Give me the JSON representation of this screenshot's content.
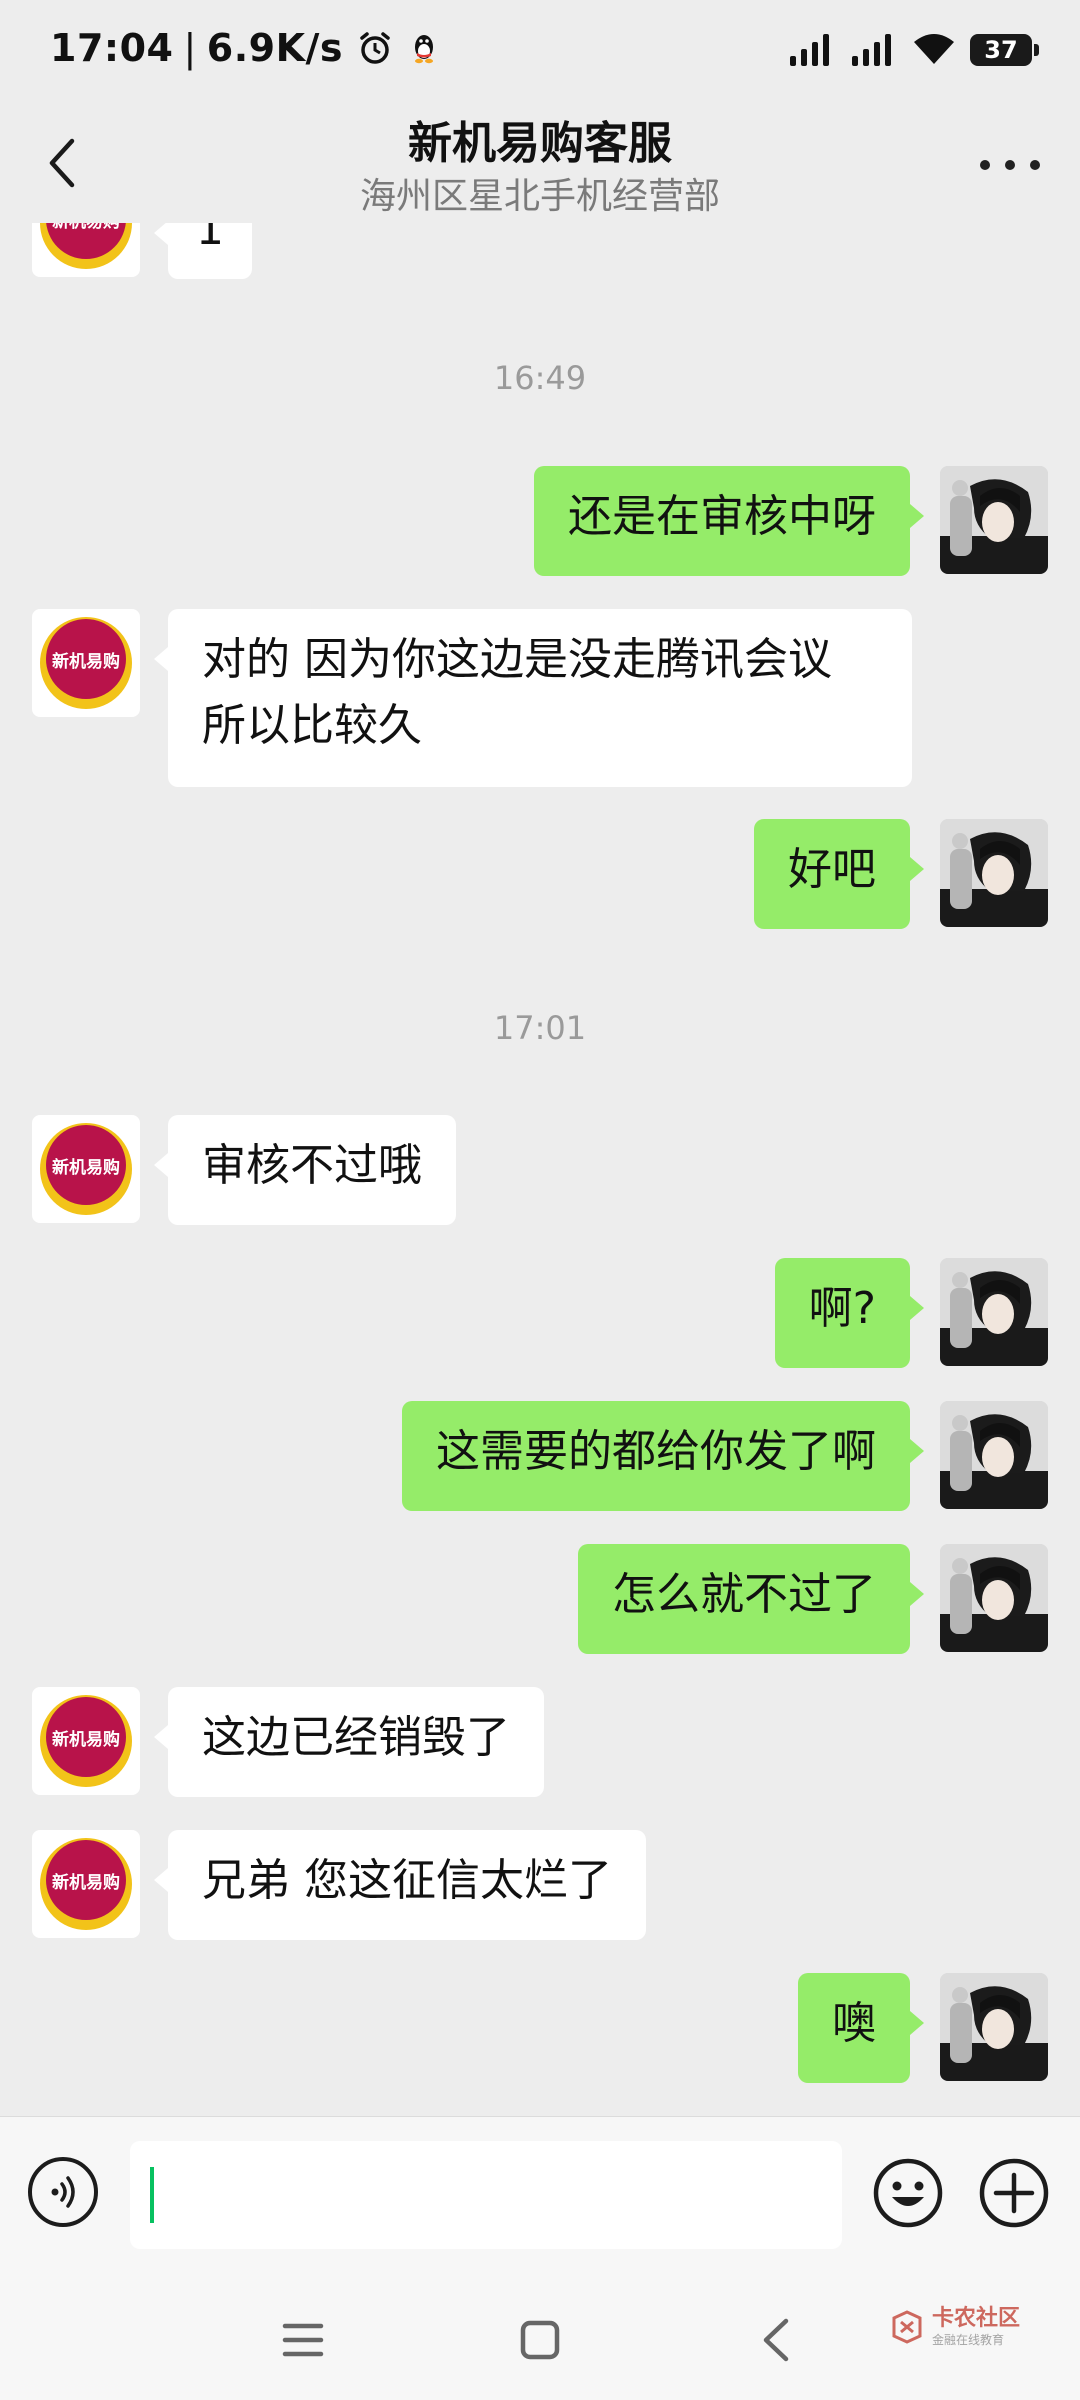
{
  "status_bar": {
    "time": "17:04",
    "speed": "6.9K/s",
    "battery": "37"
  },
  "header": {
    "title": "新机易购客服",
    "subtitle": "海州区星北手机经营部"
  },
  "contact_avatar": {
    "logo_text": "新机易购"
  },
  "messages": {
    "partial": "1",
    "time1": "16:49",
    "m1": "还是在审核中呀",
    "m2_line1": "对的 因为你这边是没走腾讯会议",
    "m2_line2": "所以比较久",
    "m3": "好吧",
    "time2": "17:01",
    "m4": "审核不过哦",
    "m5": "啊?",
    "m6": "这需要的都给你发了啊",
    "m7": "怎么就不过了",
    "m8": "这边已经销毁了",
    "m9": "兄弟 您这征信太烂了",
    "m10": "噢"
  },
  "input": {
    "value": ""
  },
  "watermark": {
    "title": "卡农社区",
    "subtitle": "金融在线教育"
  },
  "colors": {
    "outgoing_bubble": "#95ec69",
    "incoming_bubble": "#ffffff",
    "background": "#ededed",
    "caret": "#07c160"
  }
}
